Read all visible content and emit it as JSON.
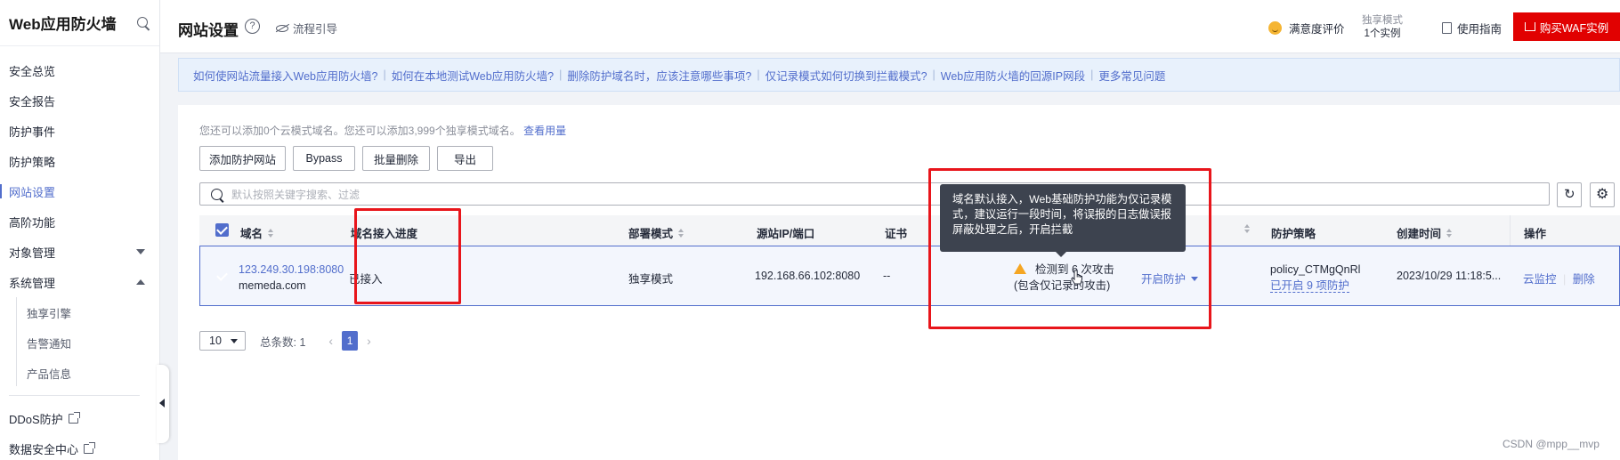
{
  "sidebar": {
    "title": "Web应用防火墙",
    "items": [
      {
        "label": "安全总览"
      },
      {
        "label": "安全报告"
      },
      {
        "label": "防护事件"
      },
      {
        "label": "防护策略"
      },
      {
        "label": "网站设置"
      },
      {
        "label": "高阶功能"
      },
      {
        "label": "对象管理"
      },
      {
        "label": "系统管理"
      }
    ],
    "sub_items": [
      {
        "label": "独享引擎"
      },
      {
        "label": "告警通知"
      },
      {
        "label": "产品信息"
      }
    ],
    "external": [
      {
        "label": "DDoS防护"
      },
      {
        "label": "数据安全中心"
      }
    ]
  },
  "header": {
    "title": "网站设置",
    "help": "?",
    "flow_guide": "流程引导",
    "satisfaction": "满意度评价",
    "mode_label": "独享模式",
    "mode_count": "1个实例",
    "usage_guide": "使用指南",
    "buy_button": "购买WAF实例"
  },
  "faq": [
    "如何使网站流量接入Web应用防火墙?",
    "如何在本地测试Web应用防火墙?",
    "删除防护域名时，应该注意哪些事项?",
    "仅记录模式如何切换到拦截模式?",
    "Web应用防火墙的回源IP网段",
    "更多常见问题"
  ],
  "main": {
    "notice": "您还可以添加0个云模式域名。您还可以添加3,999个独享模式域名。",
    "notice_link": "查看用量",
    "buttons": [
      "添加防护网站",
      "Bypass",
      "批量删除",
      "导出"
    ],
    "search_placeholder": "默认按照关键字搜索、过滤"
  },
  "table": {
    "columns": [
      "域名",
      "域名接入进度",
      "部署模式",
      "源站IP/端口",
      "证书",
      "防护策略",
      "创建时间",
      "操作"
    ],
    "row": {
      "domain_ip": "123.249.30.198:8080",
      "domain_name": "memeda.com",
      "progress": "已接入",
      "deploy_mode": "独享模式",
      "origin": "192.168.66.102:8080",
      "cert": "--",
      "attack_line1": "检测到 6 次攻击",
      "attack_line2": "(包含仅记录的攻击)",
      "protection_mode": "开启防护",
      "policy_name": "policy_CTMgQnRl",
      "policy_enabled": "已开启 9 项防护",
      "created": "2023/10/29 11:18:5...",
      "action_monitor": "云监控",
      "action_delete": "删除"
    }
  },
  "pagination": {
    "page_size": "10",
    "total": "总条数: 1",
    "current_page": "1"
  },
  "tooltip": {
    "line1": "域名默认接入，Web基础防护功能为仅记录模",
    "line2": "式，建议运行一段时间，将误报的日志做误报",
    "line3": "屏蔽处理之后，开启拦截"
  },
  "watermark": "CSDN @mpp__mvp",
  "colors": {
    "accent": "#526ecc",
    "buy": "#e10101",
    "highlight": "#e8151b",
    "warning": "#f5a623"
  }
}
